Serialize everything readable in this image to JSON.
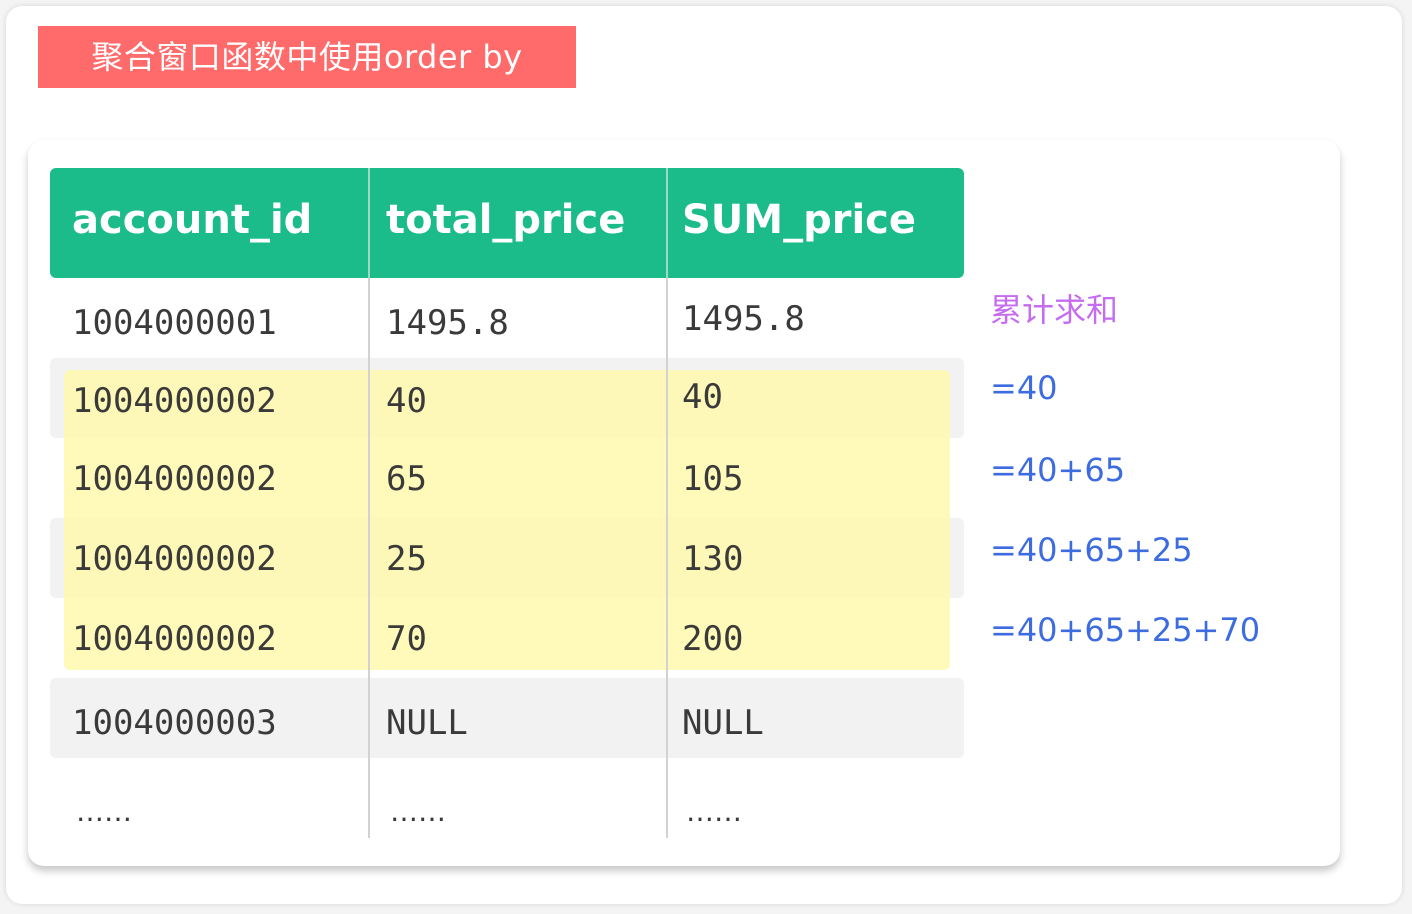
{
  "title": "聚合窗口函数中使用order by",
  "colors": {
    "title_bg": "#ff6b6b",
    "header_bg": "#1bbc8a",
    "highlight": "#fff9aa",
    "annotation_label": "#c56cf0",
    "annotation_formula": "#3d6be0"
  },
  "table": {
    "columns": [
      "account_id",
      "total_price",
      "SUM_price"
    ],
    "rows": [
      [
        "1004000001",
        "1495.8",
        "1495.8"
      ],
      [
        "1004000002",
        "40",
        "40"
      ],
      [
        "1004000002",
        "65",
        "105"
      ],
      [
        "1004000002",
        "25",
        "130"
      ],
      [
        "1004000002",
        "70",
        "200"
      ],
      [
        "1004000003",
        "NULL",
        "NULL"
      ],
      [
        "……",
        "……",
        "……"
      ]
    ]
  },
  "annotations": {
    "label": "累计求和",
    "formulas": [
      "=40",
      "=40+65",
      "=40+65+25",
      "=40+65+25+70"
    ]
  }
}
